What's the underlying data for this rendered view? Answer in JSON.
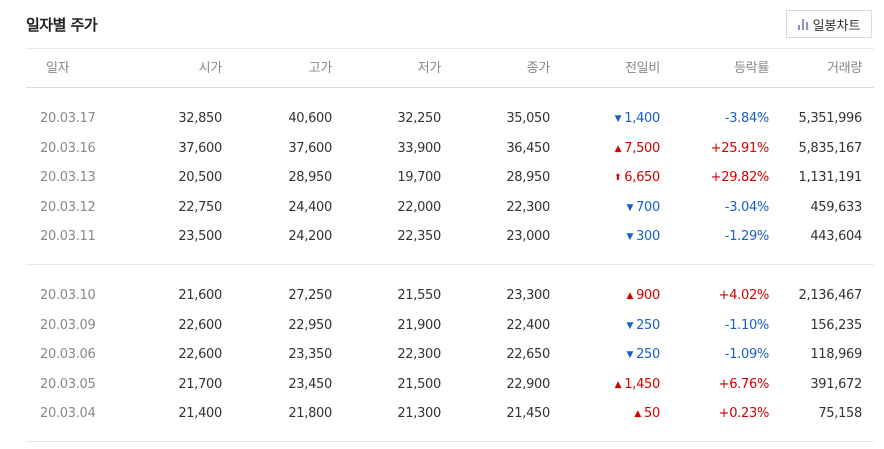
{
  "header": {
    "title": "일자별 주가",
    "chart_button_label": "일봉차트"
  },
  "table": {
    "columns": [
      "일자",
      "시가",
      "고가",
      "저가",
      "종가",
      "전일비",
      "등락률",
      "거래량"
    ],
    "groups": [
      [
        {
          "date": "20.03.17",
          "open": "32,850",
          "high": "40,600",
          "low": "32,250",
          "close": "35,050",
          "dir": "down",
          "arrow": "▼",
          "change": "1,400",
          "rate": "-3.84%",
          "volume": "5,351,996"
        },
        {
          "date": "20.03.16",
          "open": "37,600",
          "high": "37,600",
          "low": "33,900",
          "close": "36,450",
          "dir": "up",
          "arrow": "▲",
          "change": "7,500",
          "rate": "+25.91%",
          "volume": "5,835,167"
        },
        {
          "date": "20.03.13",
          "open": "20,500",
          "high": "28,950",
          "low": "19,700",
          "close": "28,950",
          "dir": "up",
          "arrow": "⬆",
          "change": "6,650",
          "rate": "+29.82%",
          "volume": "1,131,191"
        },
        {
          "date": "20.03.12",
          "open": "22,750",
          "high": "24,400",
          "low": "22,000",
          "close": "22,300",
          "dir": "down",
          "arrow": "▼",
          "change": "700",
          "rate": "-3.04%",
          "volume": "459,633"
        },
        {
          "date": "20.03.11",
          "open": "23,500",
          "high": "24,200",
          "low": "22,350",
          "close": "23,000",
          "dir": "down",
          "arrow": "▼",
          "change": "300",
          "rate": "-1.29%",
          "volume": "443,604"
        }
      ],
      [
        {
          "date": "20.03.10",
          "open": "21,600",
          "high": "27,250",
          "low": "21,550",
          "close": "23,300",
          "dir": "up",
          "arrow": "▲",
          "change": "900",
          "rate": "+4.02%",
          "volume": "2,136,467"
        },
        {
          "date": "20.03.09",
          "open": "22,600",
          "high": "22,950",
          "low": "21,900",
          "close": "22,400",
          "dir": "down",
          "arrow": "▼",
          "change": "250",
          "rate": "-1.10%",
          "volume": "156,235"
        },
        {
          "date": "20.03.06",
          "open": "22,600",
          "high": "23,350",
          "low": "22,300",
          "close": "22,650",
          "dir": "down",
          "arrow": "▼",
          "change": "250",
          "rate": "-1.09%",
          "volume": "118,969"
        },
        {
          "date": "20.03.05",
          "open": "21,700",
          "high": "23,450",
          "low": "21,500",
          "close": "22,900",
          "dir": "up",
          "arrow": "▲",
          "change": "1,450",
          "rate": "+6.76%",
          "volume": "391,672"
        },
        {
          "date": "20.03.04",
          "open": "21,400",
          "high": "21,800",
          "low": "21,300",
          "close": "21,450",
          "dir": "up",
          "arrow": "▲",
          "change": "50",
          "rate": "+0.23%",
          "volume": "75,158"
        }
      ]
    ]
  }
}
